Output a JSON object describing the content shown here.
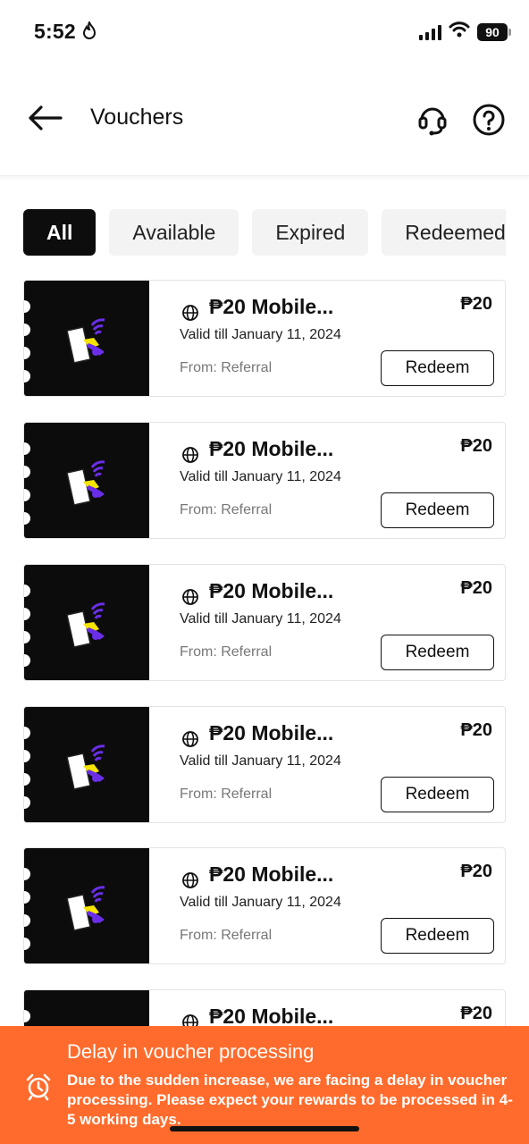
{
  "status_bar": {
    "time": "5:52",
    "battery": "90"
  },
  "header": {
    "title": "Vouchers"
  },
  "tabs": [
    {
      "label": "All",
      "active": true
    },
    {
      "label": "Available",
      "active": false
    },
    {
      "label": "Expired",
      "active": false
    },
    {
      "label": "Redeemed",
      "active": false
    }
  ],
  "vouchers": [
    {
      "title": "₱20 Mobile...",
      "amount": "₱20",
      "valid": "Valid till January 11, 2024",
      "from": "From: Referral",
      "redeem_label": "Redeem"
    },
    {
      "title": "₱20 Mobile...",
      "amount": "₱20",
      "valid": "Valid till January 11, 2024",
      "from": "From: Referral",
      "redeem_label": "Redeem"
    },
    {
      "title": "₱20 Mobile...",
      "amount": "₱20",
      "valid": "Valid till January 11, 2024",
      "from": "From: Referral",
      "redeem_label": "Redeem"
    },
    {
      "title": "₱20 Mobile...",
      "amount": "₱20",
      "valid": "Valid till January 11, 2024",
      "from": "From: Referral",
      "redeem_label": "Redeem"
    },
    {
      "title": "₱20 Mobile...",
      "amount": "₱20",
      "valid": "Valid till January 11, 2024",
      "from": "From: Referral",
      "redeem_label": "Redeem"
    },
    {
      "title": "₱20 Mobile...",
      "amount": "₱20"
    }
  ],
  "banner": {
    "title": "Delay in voucher processing",
    "text": "Due to the sudden increase, we are facing a delay in voucher processing. Please expect your rewards to be processed in 4-5 working days.",
    "icon": "alarm-clock-icon"
  },
  "colors": {
    "accent": "#ff6b2c",
    "dark": "#0d0d0d",
    "art_purple": "#6a2ee8",
    "art_yellow": "#f5e400"
  }
}
